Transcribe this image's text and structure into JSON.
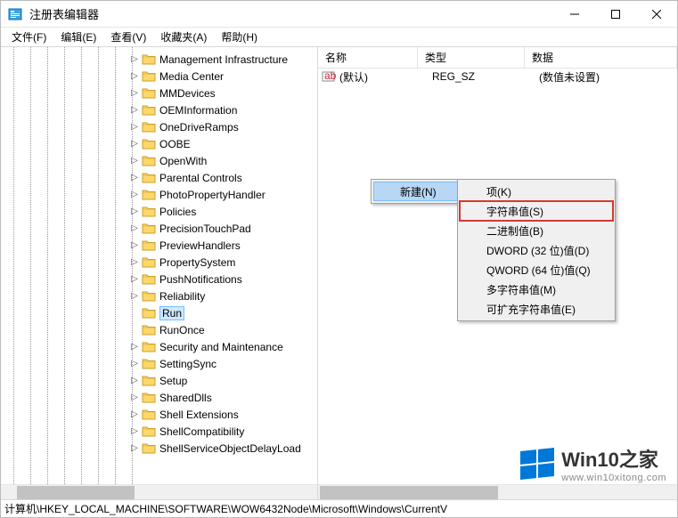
{
  "title": "注册表编辑器",
  "menu": {
    "file": "文件(F)",
    "edit": "编辑(E)",
    "view": "查看(V)",
    "favorites": "收藏夹(A)",
    "help": "帮助(H)"
  },
  "tree_items": [
    "Management Infrastructure",
    "Media Center",
    "MMDevices",
    "OEMInformation",
    "OneDriveRamps",
    "OOBE",
    "OpenWith",
    "Parental Controls",
    "PhotoPropertyHandler",
    "Policies",
    "PrecisionTouchPad",
    "PreviewHandlers",
    "PropertySystem",
    "PushNotifications",
    "Reliability",
    "Run",
    "RunOnce",
    "Security and Maintenance",
    "SettingSync",
    "Setup",
    "SharedDlls",
    "Shell Extensions",
    "ShellCompatibility",
    "ShellServiceObjectDelayLoad"
  ],
  "tree_selected_index": 15,
  "list": {
    "headers": {
      "name": "名称",
      "type": "类型",
      "data": "数据"
    },
    "rows": [
      {
        "name": "(默认)",
        "type": "REG_SZ",
        "data": "(数值未设置)",
        "kind": "sz"
      }
    ]
  },
  "context": {
    "new_label": "新建(N)",
    "sub": {
      "key": "项(K)",
      "string": "字符串值(S)",
      "binary": "二进制值(B)",
      "dword": "DWORD (32 位)值(D)",
      "qword": "QWORD (64 位)值(Q)",
      "multi": "多字符串值(M)",
      "expand": "可扩充字符串值(E)"
    }
  },
  "statusbar": "计算机\\HKEY_LOCAL_MACHINE\\SOFTWARE\\WOW6432Node\\Microsoft\\Windows\\CurrentV",
  "watermark": {
    "title": "Win10之家",
    "url": "www.win10xitong.com"
  }
}
